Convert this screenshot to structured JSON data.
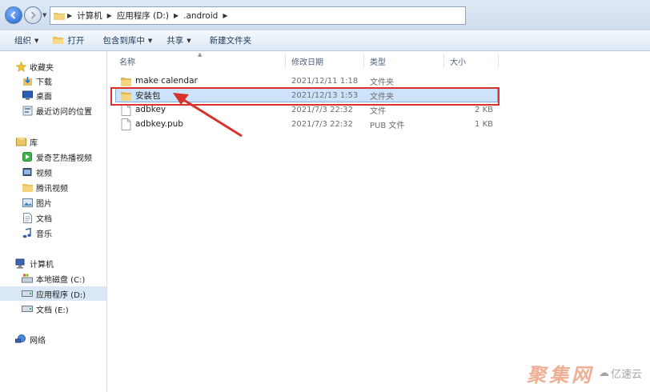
{
  "address_bar": {
    "crumbs": [
      "计算机",
      "应用程序 (D:)",
      ".android"
    ]
  },
  "toolbar": {
    "organize": "组织",
    "open": "打开",
    "include_in_library": "包含到库中",
    "share": "共享",
    "new_folder": "新建文件夹"
  },
  "sidebar": {
    "favorites": "收藏夹",
    "downloads": "下载",
    "desktop": "桌面",
    "recent": "最近访问的位置",
    "libraries": "库",
    "iqiyi": "爱奇艺热播视频",
    "videos": "视频",
    "tencent_video": "腾讯视频",
    "pictures": "图片",
    "documents": "文档",
    "music": "音乐",
    "computer": "计算机",
    "drive_c": "本地磁盘 (C:)",
    "drive_d": "应用程序 (D:)",
    "drive_e": "文档 (E:)",
    "network": "网络"
  },
  "columns": {
    "name": "名称",
    "date": "修改日期",
    "type": "类型",
    "size": "大小"
  },
  "files": [
    {
      "name": "make calendar",
      "date": "2021/12/11 1:18",
      "type": "文件夹",
      "size": ""
    },
    {
      "name": "安装包",
      "date": "2021/12/13 1:53",
      "type": "文件夹",
      "size": ""
    },
    {
      "name": "adbkey",
      "date": "2021/7/3 22:32",
      "type": "文件",
      "size": "2 KB"
    },
    {
      "name": "adbkey.pub",
      "date": "2021/7/3 22:32",
      "type": "PUB 文件",
      "size": "1 KB"
    }
  ],
  "watermark": {
    "brand": "聚集网",
    "logo_text": "亿速云"
  },
  "colors": {
    "annotation": "#d9312e",
    "selection": "#cce3fb"
  }
}
